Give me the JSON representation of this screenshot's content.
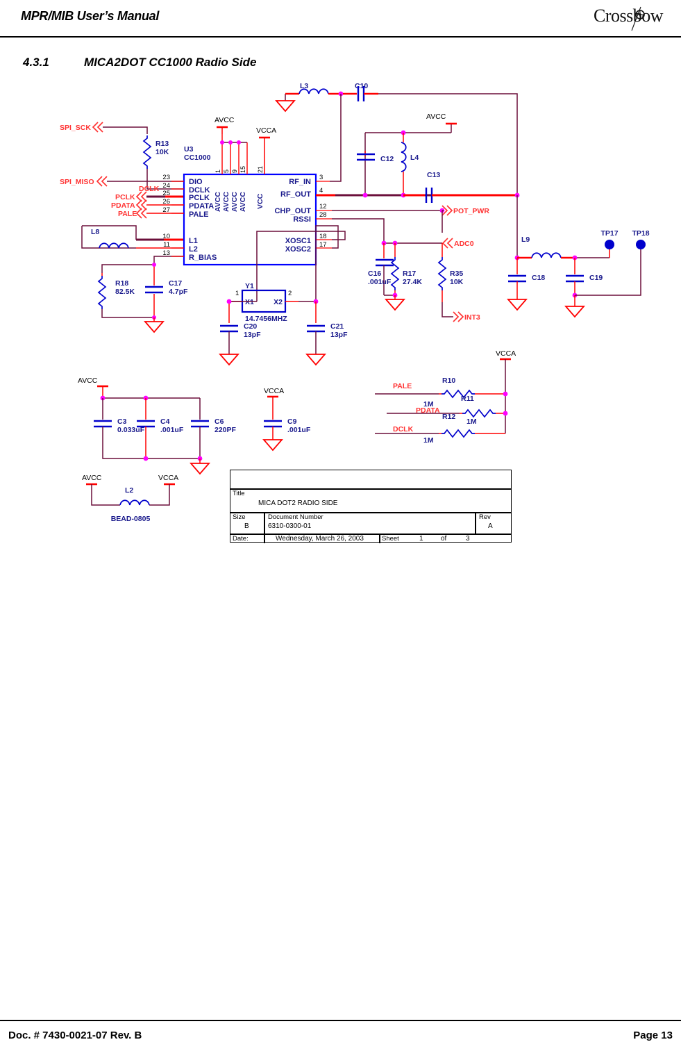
{
  "header": {
    "manual_title": "MPR/MIB User’s Manual",
    "brand": "Crossbow",
    "brand_icon": "crossbow-target-icon"
  },
  "section": {
    "number": "4.3.1",
    "title": "MICA2DOT CC1000 Radio Side"
  },
  "footer": {
    "doc_number": "Doc. # 7430-0021-07 Rev. B",
    "page": "Page 13"
  },
  "colors": {
    "wire": "#6b0f3a",
    "pin": "#ff0000",
    "component": "#0000cc",
    "label_text": "#1a1a8c",
    "net_label": "#ff3333",
    "junction": "#ff00ff",
    "ic_outline": "#0000ff",
    "testpoint": "#0000cc",
    "ground": "#ff0000"
  },
  "ic": {
    "designator": "U3",
    "part": "CC1000",
    "left_pins": [
      {
        "num": "23",
        "name": "DIO"
      },
      {
        "num": "24",
        "name": "DCLK"
      },
      {
        "num": "25",
        "name": "PCLK"
      },
      {
        "num": "26",
        "name": "PDATA"
      },
      {
        "num": "27",
        "name": "PALE"
      },
      {
        "num": "10",
        "name": "L1"
      },
      {
        "num": "11",
        "name": "L2"
      },
      {
        "num": "13",
        "name": "R_BIAS"
      }
    ],
    "top_pins": [
      {
        "num": "1",
        "name": "AVCC"
      },
      {
        "num": "5",
        "name": "AVCC"
      },
      {
        "num": "9",
        "name": "AVCC"
      },
      {
        "num": "15",
        "name": "AVCC"
      },
      {
        "num": "21",
        "name": "VCC"
      }
    ],
    "right_pins": [
      {
        "num": "3",
        "name": "RF_IN"
      },
      {
        "num": "4",
        "name": "RF_OUT"
      },
      {
        "num": "12",
        "name": "CHP_OUT"
      },
      {
        "num": "28",
        "name": "RSSI"
      },
      {
        "num": "18",
        "name": "XOSC1"
      },
      {
        "num": "17",
        "name": "XOSC2"
      }
    ]
  },
  "net_labels": [
    {
      "name": "SPI_SCK",
      "dir": "in"
    },
    {
      "name": "SPI_MISO",
      "dir": "in"
    },
    {
      "name": "PCLK",
      "dir": "in"
    },
    {
      "name": "PDATA",
      "dir": "in"
    },
    {
      "name": "PALE",
      "dir": "in"
    },
    {
      "name": "DCLK",
      "dir": "plain"
    },
    {
      "name": "POT_PWR",
      "dir": "out"
    },
    {
      "name": "ADC0",
      "dir": "in"
    },
    {
      "name": "INT3",
      "dir": "out"
    }
  ],
  "power_labels": [
    "AVCC",
    "VCCA",
    "AVCC",
    "AVCC",
    "VCCA",
    "AVCC",
    "VCCA",
    "AVCC",
    "VCCA"
  ],
  "components": [
    {
      "ref": "R13",
      "value": "10K",
      "type": "resistor"
    },
    {
      "ref": "R18",
      "value": "82.5K",
      "type": "resistor"
    },
    {
      "ref": "R17",
      "value": "27.4K",
      "type": "resistor"
    },
    {
      "ref": "R35",
      "value": "10K",
      "type": "resistor"
    },
    {
      "ref": "R10",
      "value": "1M",
      "type": "resistor"
    },
    {
      "ref": "R11",
      "value": "1M",
      "type": "resistor"
    },
    {
      "ref": "R12",
      "value": "1M",
      "type": "resistor"
    },
    {
      "ref": "C3",
      "value": "0.033uF",
      "type": "capacitor"
    },
    {
      "ref": "C4",
      "value": ".001uF",
      "type": "capacitor"
    },
    {
      "ref": "C6",
      "value": "220PF",
      "type": "capacitor"
    },
    {
      "ref": "C9",
      "value": ".001uF",
      "type": "capacitor"
    },
    {
      "ref": "C10",
      "value": "",
      "type": "capacitor"
    },
    {
      "ref": "C12",
      "value": "",
      "type": "capacitor"
    },
    {
      "ref": "C13",
      "value": "",
      "type": "capacitor"
    },
    {
      "ref": "C16",
      "value": ".001uF",
      "type": "capacitor"
    },
    {
      "ref": "C17",
      "value": "4.7pF",
      "type": "capacitor"
    },
    {
      "ref": "C18",
      "value": "",
      "type": "capacitor"
    },
    {
      "ref": "C19",
      "value": "",
      "type": "capacitor"
    },
    {
      "ref": "C20",
      "value": "13pF",
      "type": "capacitor"
    },
    {
      "ref": "C21",
      "value": "13pF",
      "type": "capacitor"
    },
    {
      "ref": "L2",
      "value": "BEAD-0805",
      "type": "inductor"
    },
    {
      "ref": "L3",
      "value": "",
      "type": "inductor"
    },
    {
      "ref": "L4",
      "value": "",
      "type": "inductor"
    },
    {
      "ref": "L8",
      "value": "",
      "type": "inductor"
    },
    {
      "ref": "L9",
      "value": "",
      "type": "inductor"
    },
    {
      "ref": "Y1",
      "value": "14.7456MHZ",
      "type": "crystal",
      "pin1": "1",
      "pin2": "2",
      "pad1": "X1",
      "pad2": "X2"
    },
    {
      "ref": "TP17",
      "value": "",
      "type": "testpoint"
    },
    {
      "ref": "TP18",
      "value": "",
      "type": "testpoint"
    }
  ],
  "title_block": {
    "title_label": "Title",
    "title_value": "MICA DOT2 RADIO SIDE",
    "size_label": "Size",
    "size_value": "B",
    "docnum_label": "Document Number",
    "docnum_value": "6310-0300-01",
    "rev_label": "Rev",
    "rev_value": "A",
    "date_label": "Date:",
    "date_value": "Wednesday, March 26, 2003",
    "sheet_label": "Sheet",
    "sheet_num": "1",
    "sheet_of": "of",
    "sheet_total": "3"
  }
}
